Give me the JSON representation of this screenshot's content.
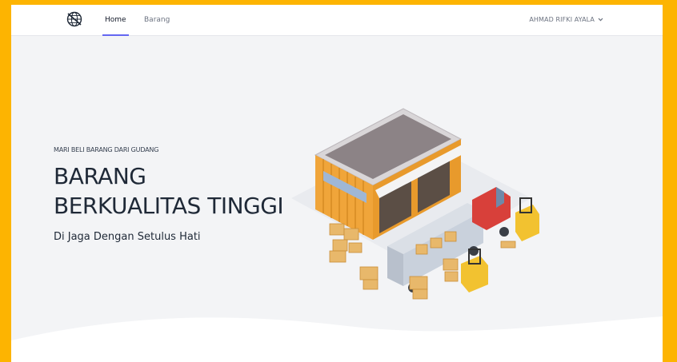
{
  "navbar": {
    "logo_icon": "globe-logo-icon",
    "links": [
      {
        "label": "Home",
        "active": true
      },
      {
        "label": "Barang",
        "active": false
      }
    ],
    "user_name": "AHMAD RIFKI AYALA",
    "user_menu_icon": "chevron-down-icon"
  },
  "hero": {
    "kicker": "MARI BELI BARANG DARI GUDANG",
    "headline_line1": "BARANG",
    "headline_line2": "BERKUALITAS TINGGI",
    "subline": "Di Jaga Dengan Setulus Hati",
    "illustration": "warehouse-truck-forklift-illustration"
  },
  "colors": {
    "page_border": "#FDB401",
    "background": "#F3F4F6",
    "navbar": "#FFFFFF",
    "active_underline": "#6366F1",
    "text_dark": "#1F2937",
    "text_muted": "#6B7280"
  }
}
